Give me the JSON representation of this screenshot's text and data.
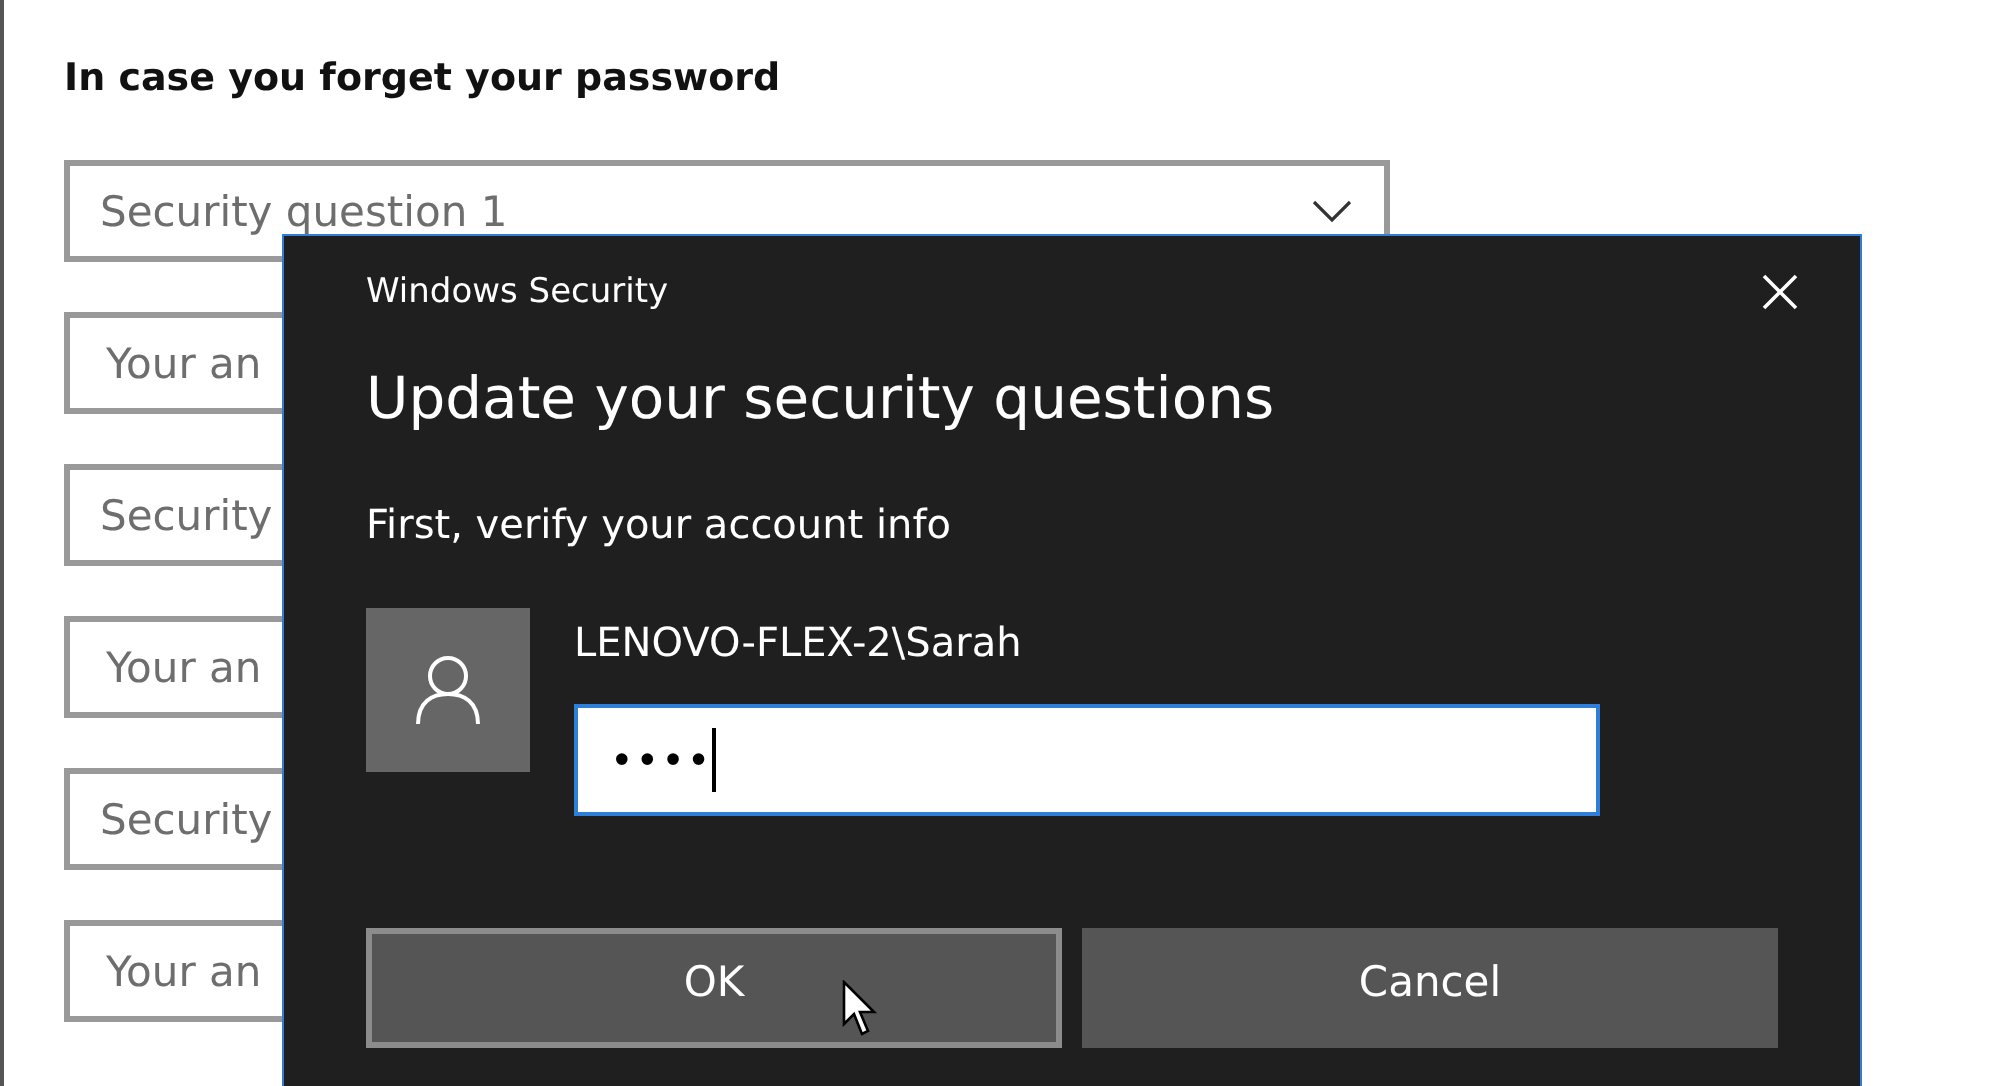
{
  "background": {
    "heading": "In case you forget your password",
    "fields": [
      {
        "kind": "dropdown",
        "placeholder": "Security question 1"
      },
      {
        "kind": "text",
        "placeholder": "Your an"
      },
      {
        "kind": "dropdown",
        "placeholder": "Security"
      },
      {
        "kind": "text",
        "placeholder": "Your an"
      },
      {
        "kind": "dropdown",
        "placeholder": "Security"
      },
      {
        "kind": "text",
        "placeholder": "Your an"
      }
    ]
  },
  "dialog": {
    "title": "Windows Security",
    "heading": "Update your security questions",
    "subheading": "First, verify your account info",
    "account": {
      "username": "LENOVO-FLEX-2\\Sarah",
      "password": "••••"
    },
    "buttons": [
      {
        "label": "OK",
        "focused": true
      },
      {
        "label": "Cancel",
        "focused": false
      }
    ]
  }
}
